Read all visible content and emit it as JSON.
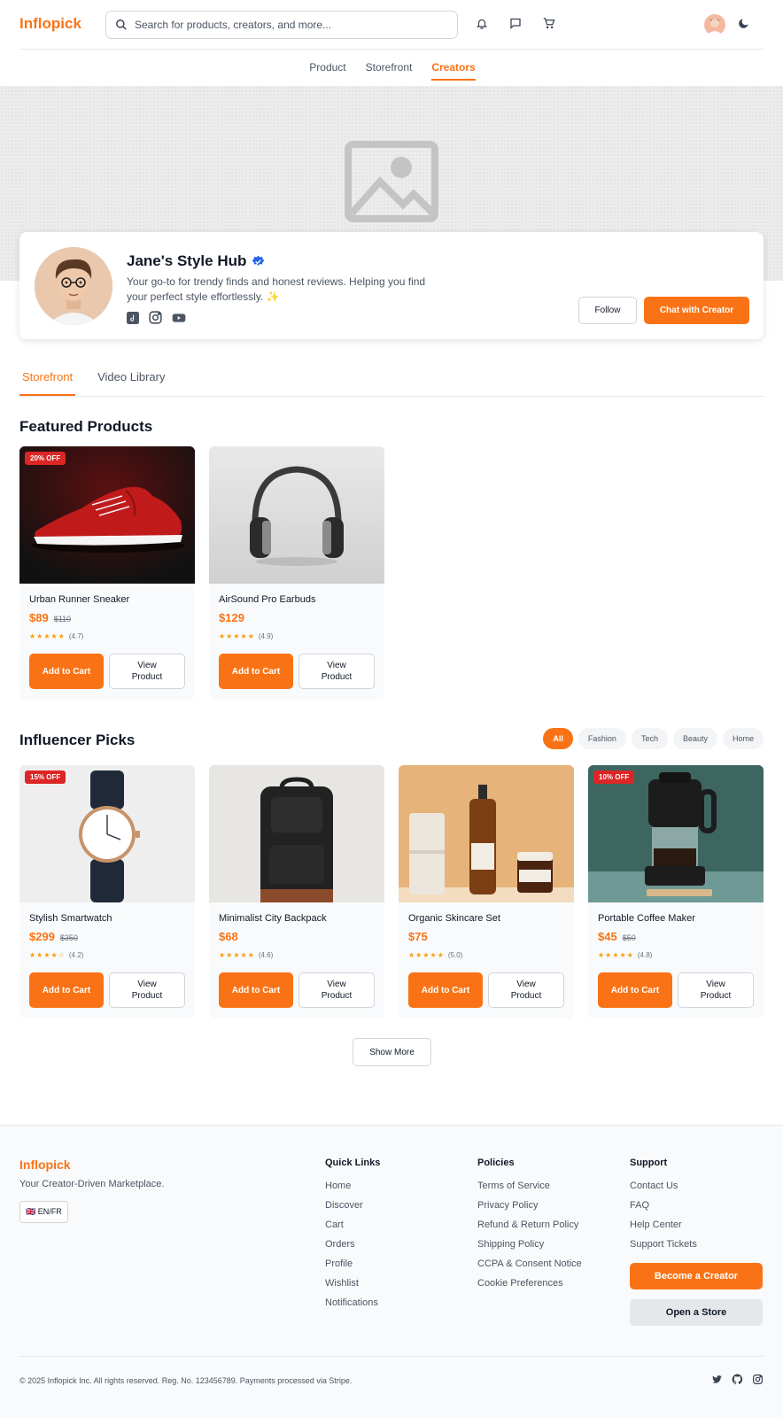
{
  "brand": {
    "name": "Inflopick",
    "accent": "#f97316"
  },
  "search": {
    "placeholder": "Search for products, creators, and more..."
  },
  "header_icons": [
    "bell-icon",
    "chat-icon",
    "cart-icon",
    "avatar",
    "moon-icon"
  ],
  "nav": {
    "items": [
      {
        "label": "Product"
      },
      {
        "label": "Storefront"
      },
      {
        "label": "Creators",
        "active": true
      }
    ]
  },
  "creator": {
    "name": "Jane's Style Hub",
    "verified": true,
    "bio": "Your go-to for trendy finds and honest reviews. Helping you find your perfect style effortlessly. ✨",
    "socials": [
      "tiktok-icon",
      "instagram-icon",
      "youtube-icon"
    ],
    "follow_label": "Follow",
    "chat_label": "Chat with Creator"
  },
  "tabs": [
    {
      "label": "Storefront",
      "active": true
    },
    {
      "label": "Video Library"
    }
  ],
  "featured": {
    "title": "Featured Products",
    "products": [
      {
        "name": "Urban Runner Sneaker",
        "price": "$89",
        "old_price": "$110",
        "badge": "20% OFF",
        "stars": "★★★★★",
        "rating": "(4.7)",
        "image": "red-sneaker"
      },
      {
        "name": "AirSound Pro Earbuds",
        "price": "$129",
        "old_price": "",
        "badge": "",
        "stars": "★★★★★",
        "rating": "(4.9)",
        "image": "headphones"
      }
    ]
  },
  "picks": {
    "title": "Influencer Picks",
    "filters": [
      {
        "label": "All",
        "active": true
      },
      {
        "label": "Fashion"
      },
      {
        "label": "Tech"
      },
      {
        "label": "Beauty"
      },
      {
        "label": "Home"
      }
    ],
    "products": [
      {
        "name": "Stylish Smartwatch",
        "price": "$299",
        "old_price": "$350",
        "badge": "15% OFF",
        "stars": "★★★★☆",
        "rating": "(4.2)",
        "image": "watch"
      },
      {
        "name": "Minimalist City Backpack",
        "price": "$68",
        "old_price": "",
        "badge": "",
        "stars": "★★★★★",
        "rating": "(4.6)",
        "image": "backpack"
      },
      {
        "name": "Organic Skincare Set",
        "price": "$75",
        "old_price": "",
        "badge": "",
        "stars": "★★★★★",
        "rating": "(5.0)",
        "image": "skincare"
      },
      {
        "name": "Portable Coffee Maker",
        "price": "$45",
        "old_price": "$50",
        "badge": "10% OFF",
        "stars": "★★★★★",
        "rating": "(4.8)",
        "image": "coffee-maker"
      }
    ],
    "show_more_label": "Show More"
  },
  "buttons": {
    "add_to_cart": "Add to Cart",
    "view_product": "View Product"
  },
  "footer": {
    "logo": "Inflopick",
    "tagline": "Your Creator-Driven Marketplace.",
    "language": "🇬🇧 EN/FR",
    "columns": [
      {
        "title": "Quick Links",
        "links": [
          "Home",
          "Discover",
          "Cart",
          "Orders",
          "Profile",
          "Wishlist",
          "Notifications"
        ]
      },
      {
        "title": "Policies",
        "links": [
          "Terms of Service",
          "Privacy Policy",
          "Refund & Return Policy",
          "Shipping Policy",
          "CCPA & Consent Notice",
          "Cookie Preferences"
        ]
      },
      {
        "title": "Support",
        "links": [
          "Contact Us",
          "FAQ",
          "Help Center",
          "Support Tickets"
        ]
      }
    ],
    "become_creator_label": "Become a Creator",
    "open_store_label": "Open a Store",
    "copyright": "© 2025 Inflopick Inc. All rights reserved. Reg. No. 123456789. Payments processed via Stripe.",
    "socials": [
      "twitter-icon",
      "github-icon",
      "instagram-icon"
    ]
  }
}
